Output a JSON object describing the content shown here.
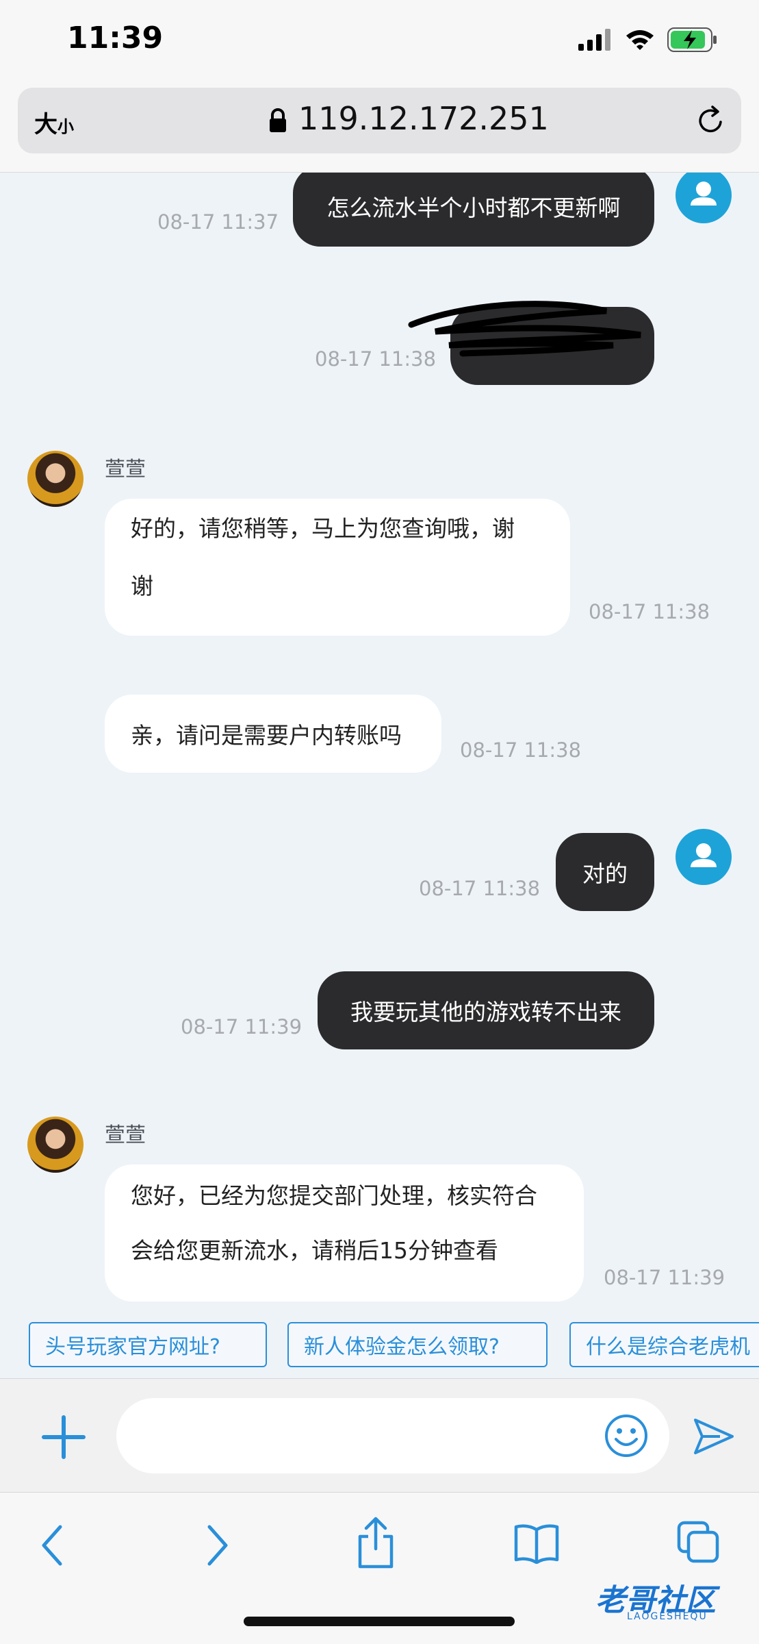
{
  "status_bar": {
    "time": "11:39"
  },
  "browser": {
    "text_size": "大",
    "text_size_small": "小",
    "url": "119.12.172.251"
  },
  "agent": {
    "name": "萱萱"
  },
  "messages": [
    {
      "side": "out",
      "text": "怎么流水半个小时都不更新啊",
      "time": "08-17 11:37"
    },
    {
      "side": "out",
      "text": "",
      "time": "08-17 11:38"
    },
    {
      "side": "in",
      "line1": "好的，请您稍等，马上为您查询哦，谢",
      "line2": "谢",
      "time": "08-17 11:38"
    },
    {
      "side": "in",
      "text": "亲，请问是需要户内转账吗",
      "time": "08-17 11:38"
    },
    {
      "side": "out",
      "text": "对的",
      "time": "08-17 11:38"
    },
    {
      "side": "out",
      "text": "我要玩其他的游戏转不出来",
      "time": "08-17 11:39"
    },
    {
      "side": "in",
      "line1": "您好，已经为您提交部门处理，核实符合",
      "line2": "会给您更新流水，请稍后15分钟查看",
      "time": "08-17 11:39"
    }
  ],
  "quick_replies": [
    "头号玩家官方网址?",
    "新人体验金怎么领取?",
    "什么是综合老虎机"
  ],
  "input": {
    "placeholder": ""
  },
  "watermark": {
    "text": "老哥社区",
    "sub": "LAOGESHEQU"
  },
  "colors": {
    "accent": "#2a8fd9",
    "outgoing_bubble": "#2b2b2d",
    "incoming_bubble": "#ffffff",
    "user_avatar": "#1ea3d8"
  }
}
